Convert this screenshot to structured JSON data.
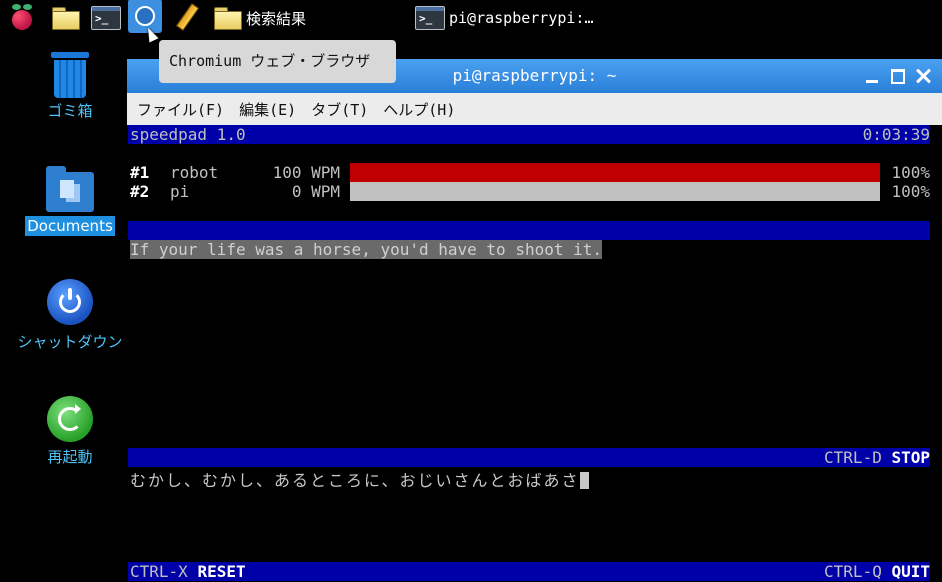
{
  "taskbar": {
    "items": [
      {
        "name": "raspberry-menu",
        "icon": "raspberry-icon"
      },
      {
        "name": "file-manager",
        "icon": "folder-icon"
      },
      {
        "name": "terminal-launcher",
        "icon": "terminal-icon"
      },
      {
        "name": "chromium-launcher",
        "icon": "chromium-icon"
      },
      {
        "name": "text-editor",
        "icon": "pencil-icon"
      }
    ],
    "folder_window_label": "検索結果",
    "terminal_window_label": "pi@raspberrypi:…",
    "tooltip": "Chromium ウェブ・ブラウザ"
  },
  "desktop": {
    "trash_label": "ゴミ箱",
    "documents_label": "Documents",
    "shutdown_label": "シャットダウン",
    "reboot_label": "再起動"
  },
  "window": {
    "title": "pi@raspberrypi: ~",
    "menus": [
      "ファイル(F)",
      "編集(E)",
      "タブ(T)",
      "ヘルプ(H)"
    ]
  },
  "terminal": {
    "app_title": "speedpad 1.0",
    "timer": "0:03:39",
    "players": [
      {
        "rank": "#1",
        "name": "robot",
        "wpm": "100 WPM",
        "progress": 1.0,
        "percent": "100%",
        "bar_color": "#c00000"
      },
      {
        "rank": "#2",
        "name": "pi",
        "wpm": "0 WPM",
        "progress": 1.0,
        "percent": "100%",
        "bar_color": "#c0c0c0"
      }
    ],
    "sentence": "If your life was a horse, you'd have to shoot it.",
    "stop_hint": "CTRL-D",
    "stop_label": "STOP",
    "typed_text": "むかし、むかし、あるところに、おじいさんとおばあさ",
    "reset_hint": "CTRL-X",
    "reset_label": "RESET",
    "quit_hint": "CTRL-Q",
    "quit_label": "QUIT"
  },
  "colors": {
    "titlebar": "#2a7fd8",
    "status_bar": "#0000a8",
    "desktop_label": "#4fc3f7"
  }
}
